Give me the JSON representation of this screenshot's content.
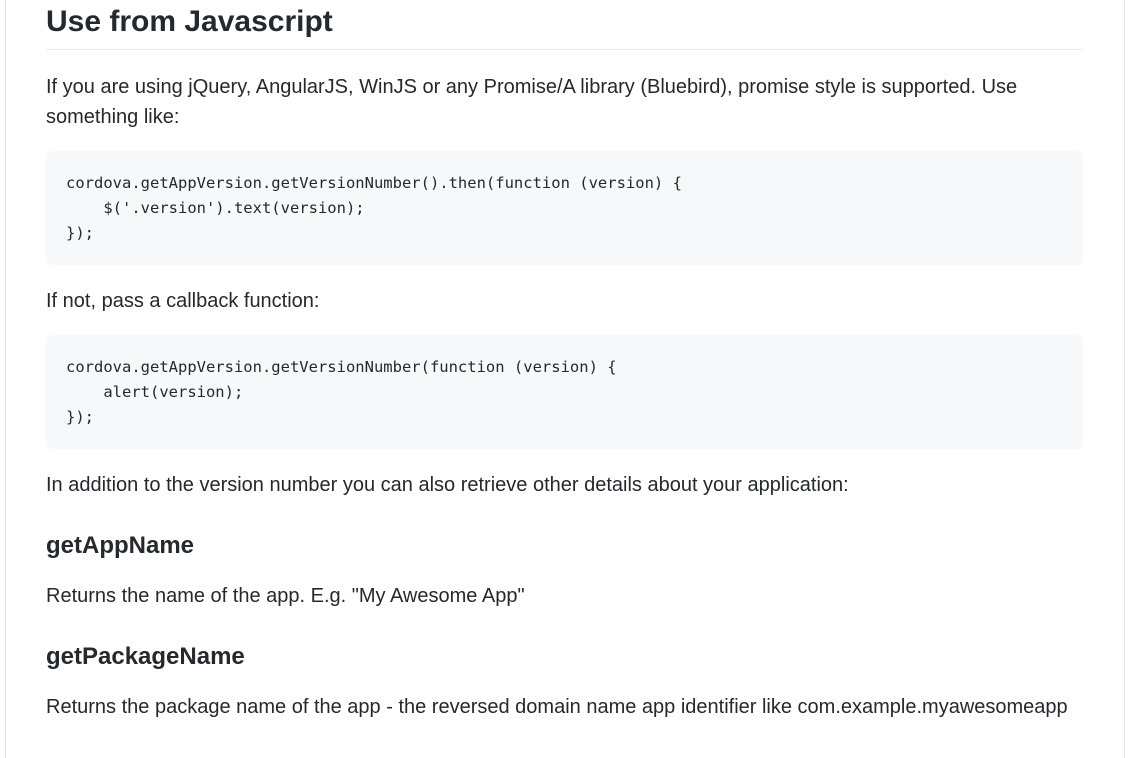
{
  "section": {
    "title": "Use from Javascript"
  },
  "intro": {
    "line1": "If you are using jQuery, AngularJS, WinJS or any Promise/A library (Bluebird), promise style is supported. Use",
    "line2": "something like:"
  },
  "code_promise": {
    "text": "cordova.getAppVersion.getVersionNumber().then(function (version) {\n    $('.version').text(version);\n});"
  },
  "callback_intro": {
    "text": "If not, pass a callback function:"
  },
  "code_callback": {
    "text": "cordova.getAppVersion.getVersionNumber(function (version) {\n    alert(version);\n});"
  },
  "details_intro": {
    "text": "In addition to the version number you can also retrieve other details about your application:"
  },
  "methods": [
    {
      "name": "getAppName",
      "description": "Returns the name of the app. E.g. \"My Awesome App\""
    },
    {
      "name": "getPackageName",
      "description": "Returns the package name of the app - the reversed domain name app identifier like com.example.myawesomeapp"
    }
  ]
}
